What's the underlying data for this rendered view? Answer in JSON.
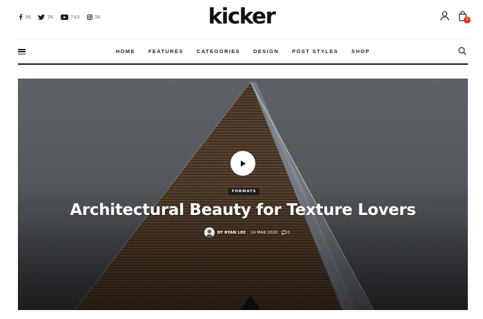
{
  "colors": {
    "accent": "#e03020",
    "text": "#111111",
    "hero_sky": "#5d6166",
    "wood": "#5b4430"
  },
  "social": [
    {
      "icon": "facebook-icon",
      "count": "3K"
    },
    {
      "icon": "twitter-icon",
      "count": "3K"
    },
    {
      "icon": "youtube-icon",
      "count": "740"
    },
    {
      "icon": "instagram-icon",
      "count": "3K"
    }
  ],
  "header": {
    "logo": "kicker",
    "cart_count": "0"
  },
  "nav": {
    "items": [
      "HOME",
      "FEATURES",
      "CATEGORIES",
      "DESIGN",
      "POST STYLES",
      "SHOP"
    ]
  },
  "hero": {
    "category": "FORMATS",
    "title": "Architectural Beauty for Texture Lovers",
    "author": "BY RYAN LEE",
    "date": "14 MAR 2020",
    "comments": "0"
  }
}
